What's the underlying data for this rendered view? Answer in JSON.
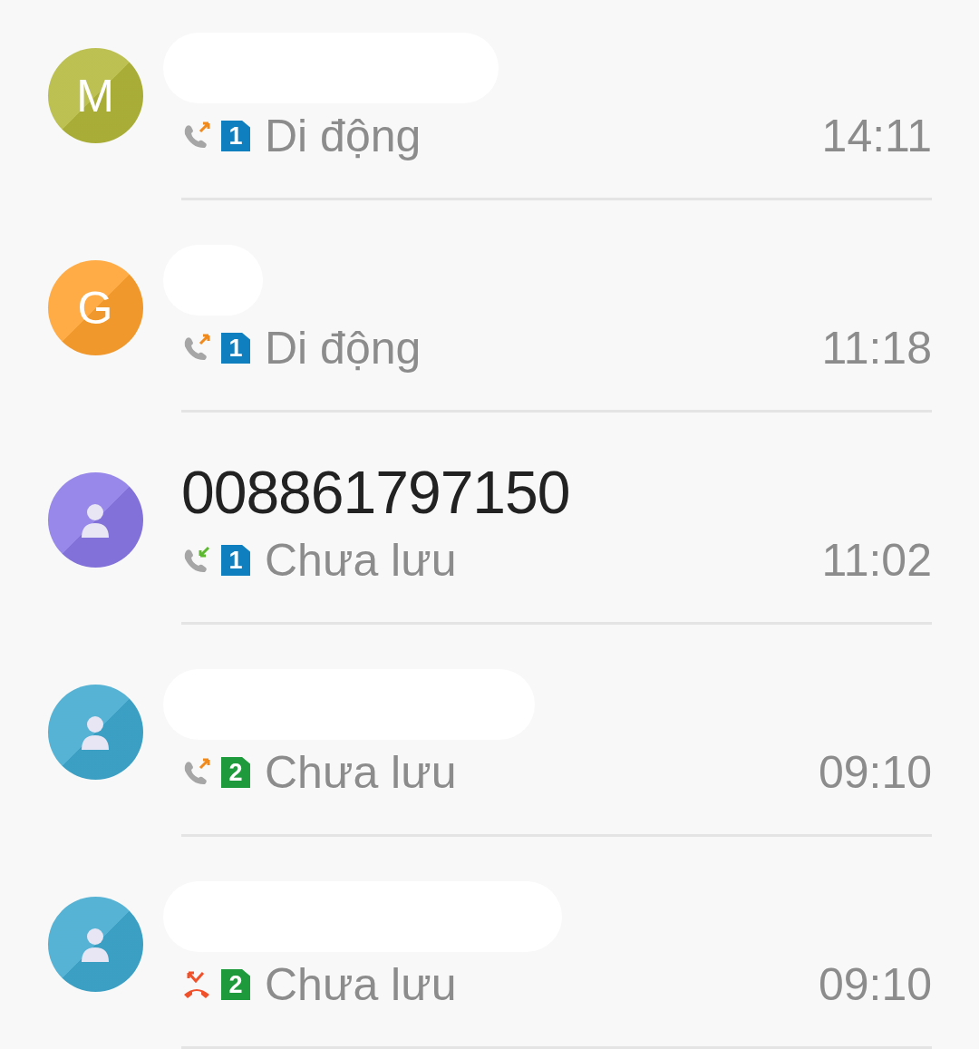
{
  "calls": [
    {
      "avatar": {
        "kind": "letter",
        "letter": "M",
        "color": "#b3b83a"
      },
      "name_hidden": true,
      "kind": "outgoing",
      "sim": {
        "number": "1",
        "color": "#0f7fc0"
      },
      "label": "Di động",
      "time": "14:11"
    },
    {
      "avatar": {
        "kind": "letter",
        "letter": "G",
        "color": "#ffa12e"
      },
      "name_hidden": true,
      "kind": "outgoing",
      "sim": {
        "number": "1",
        "color": "#0f7fc0"
      },
      "label": "Di động",
      "time": "11:18"
    },
    {
      "avatar": {
        "kind": "person",
        "color": "#8a78e6"
      },
      "name_hidden": false,
      "name": "008861797150",
      "kind": "incoming",
      "sim": {
        "number": "1",
        "color": "#0f7fc0"
      },
      "label": "Chưa lưu",
      "time": "11:02"
    },
    {
      "avatar": {
        "kind": "person",
        "color": "#3fa9cf"
      },
      "name_hidden": true,
      "kind": "outgoing",
      "sim": {
        "number": "2",
        "color": "#1e9a3c"
      },
      "label": "Chưa lưu",
      "time": "09:10"
    },
    {
      "avatar": {
        "kind": "person",
        "color": "#3fa9cf"
      },
      "name_hidden": true,
      "kind": "missed",
      "sim": {
        "number": "2",
        "color": "#1e9a3c"
      },
      "label": "Chưa lưu",
      "time": "09:10"
    }
  ]
}
